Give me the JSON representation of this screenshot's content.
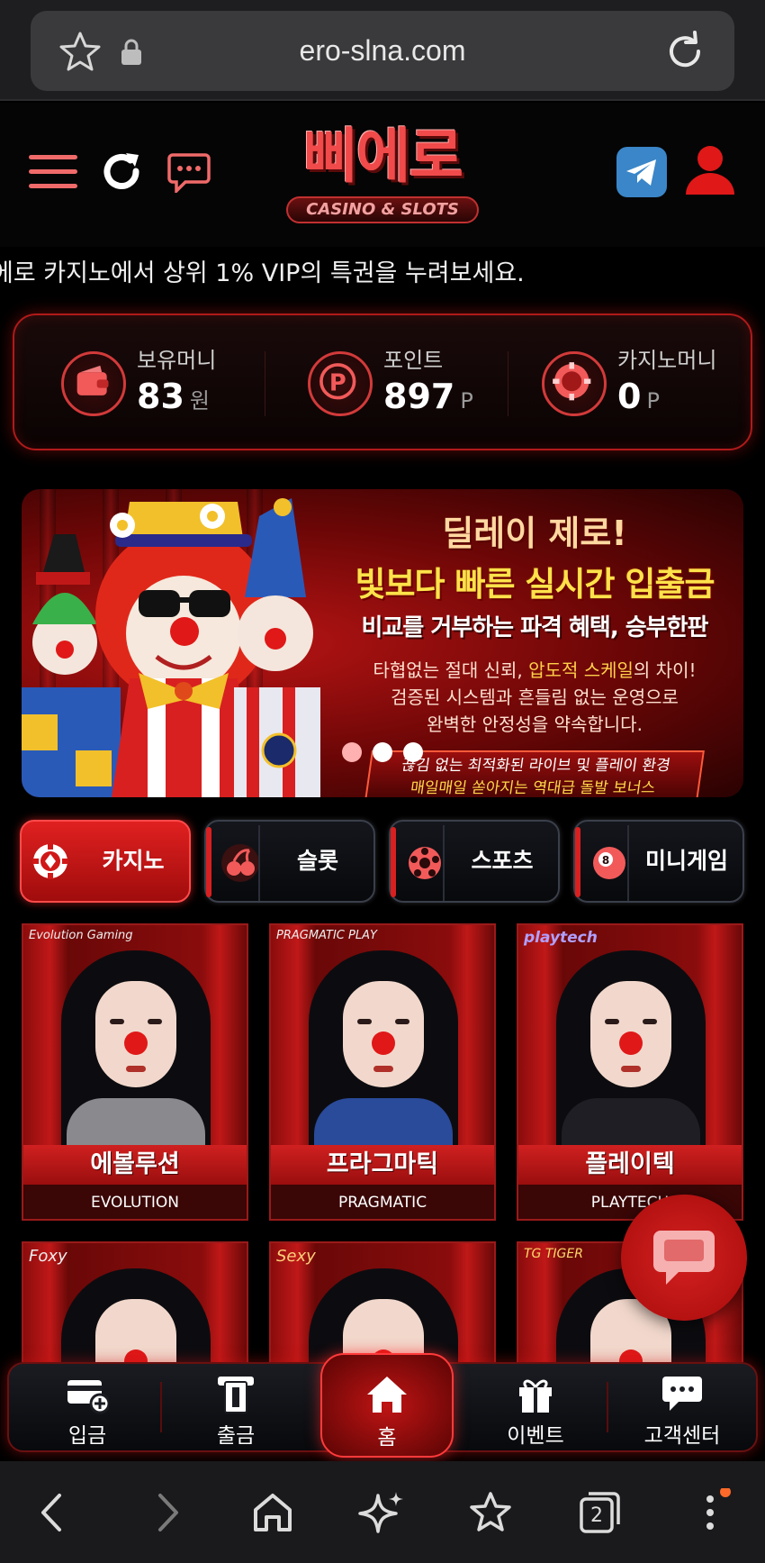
{
  "browser": {
    "url": "ero-slna.com",
    "icons": [
      "star-icon",
      "lock-icon",
      "reload-icon"
    ],
    "tab_count": "2"
  },
  "header": {
    "logo_main": "삐에로",
    "logo_sub": "CASINO & SLOTS",
    "icons": [
      "menu-icon",
      "refresh-icon",
      "chat-icon",
      "telegram-icon",
      "user-icon"
    ]
  },
  "marquee": {
    "text": "에로 카지노에서 상위 1% VIP의 특권을 누려보세요."
  },
  "balances": [
    {
      "label": "보유머니",
      "value": "83",
      "unit": "원",
      "icon": "wallet-icon"
    },
    {
      "label": "포인트",
      "value": "897",
      "unit": "P",
      "icon": "point-icon"
    },
    {
      "label": "카지노머니",
      "value": "0",
      "unit": "P",
      "icon": "chip-icon"
    }
  ],
  "banner": {
    "title": "딜레이 제로!",
    "headline": "빛보다 빠른 실시간 입출금",
    "sub": "비교를 거부하는 파격 혜택, 승부한판",
    "body_line1_a": "타협없는 절대 신뢰, ",
    "body_line1_b": "압도적 스케일",
    "body_line1_c": "의 차이!",
    "body_line2": "검증된 시스템과 흔들림 없는 운영으로",
    "body_line3": "완벽한 안정성을 약속합니다.",
    "box_line1": "끊김 없는 최적화된 라이브 및 플레이 환경",
    "box_line2": "매일매일 쏟아지는 역대급 돌발 보너스",
    "slide_count": 3,
    "active_slide": 1
  },
  "tabs": [
    {
      "label": "카지노",
      "icon": "casino-chip-icon",
      "active": true
    },
    {
      "label": "슬롯",
      "icon": "cherry-icon",
      "active": false
    },
    {
      "label": "스포츠",
      "icon": "soccer-ball-icon",
      "active": false
    },
    {
      "label": "미니게임",
      "icon": "ball-8-icon",
      "active": false
    }
  ],
  "games": [
    {
      "provider": "Evolution Gaming",
      "name_ko": "에볼루션",
      "name_en": "EVOLUTION"
    },
    {
      "provider": "PRAGMATIC PLAY",
      "name_ko": "프라그마틱",
      "name_en": "PRAGMATIC"
    },
    {
      "provider": "playtech",
      "name_ko": "플레이텍",
      "name_en": "PLAYTECH"
    },
    {
      "provider": "Foxy",
      "name_ko": "",
      "name_en": ""
    },
    {
      "provider": "Sexy",
      "name_ko": "",
      "name_en": ""
    },
    {
      "provider": "TG TIGER",
      "name_ko": "",
      "name_en": ""
    }
  ],
  "bottom_nav": [
    {
      "label": "입금",
      "icon": "deposit-card-icon"
    },
    {
      "label": "출금",
      "icon": "withdraw-icon"
    },
    {
      "label": "홈",
      "icon": "home-icon"
    },
    {
      "label": "이벤트",
      "icon": "gift-icon"
    },
    {
      "label": "고객센터",
      "icon": "support-chat-icon"
    }
  ],
  "colors": {
    "accent": "#e02020",
    "dark": "#050505",
    "notification_dot": "#ff6a2a"
  }
}
